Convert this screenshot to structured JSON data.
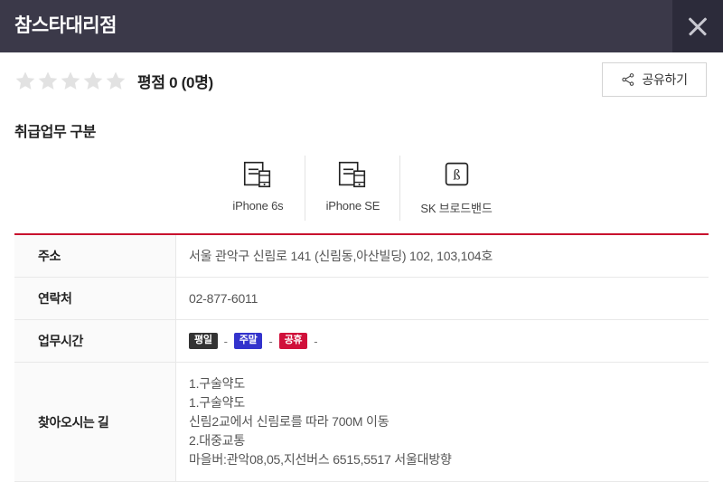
{
  "header": {
    "title": "참스타대리점",
    "close_icon": "close-icon"
  },
  "rating": {
    "star_count": 5,
    "filled_stars": 0,
    "star_color": "#e2e2e2",
    "text": "평점 0 (0명)"
  },
  "share": {
    "label": "공유하기",
    "icon": "share-icon"
  },
  "services_section": {
    "title": "취급업무 구분",
    "items": [
      {
        "label": "iPhone 6s",
        "icon": "device-document-icon"
      },
      {
        "label": "iPhone SE",
        "icon": "device-document-icon"
      },
      {
        "label": "SK 브로드밴드",
        "icon": "broadband-b-icon"
      }
    ]
  },
  "info_table": {
    "accent_color": "#c8102e",
    "rows": [
      {
        "label": "주소",
        "value": "서울 관악구 신림로 141 (신림동,아산빌딩) 102, 103,104호"
      },
      {
        "label": "연락처",
        "value": "02-877-6011"
      },
      {
        "label": "업무시간",
        "value": ""
      },
      {
        "label": "찾아오시는 길",
        "value": ""
      }
    ],
    "hours": {
      "label": "업무시간",
      "badges": [
        {
          "text": "평일",
          "color": "#333333",
          "value": "-"
        },
        {
          "text": "주말",
          "color": "#3333cc",
          "value": "-"
        },
        {
          "text": "공휴",
          "color": "#d0103a",
          "value": "-"
        }
      ]
    },
    "directions": {
      "label": "찾아오시는 길",
      "lines": [
        "1.구술약도",
        "1.구술약도",
        "신림2교에서 신림로를 따라 700M 이동",
        "2.대중교통",
        "마을버:관악08,05,지선버스 6515,5517 서울대방향"
      ]
    }
  }
}
